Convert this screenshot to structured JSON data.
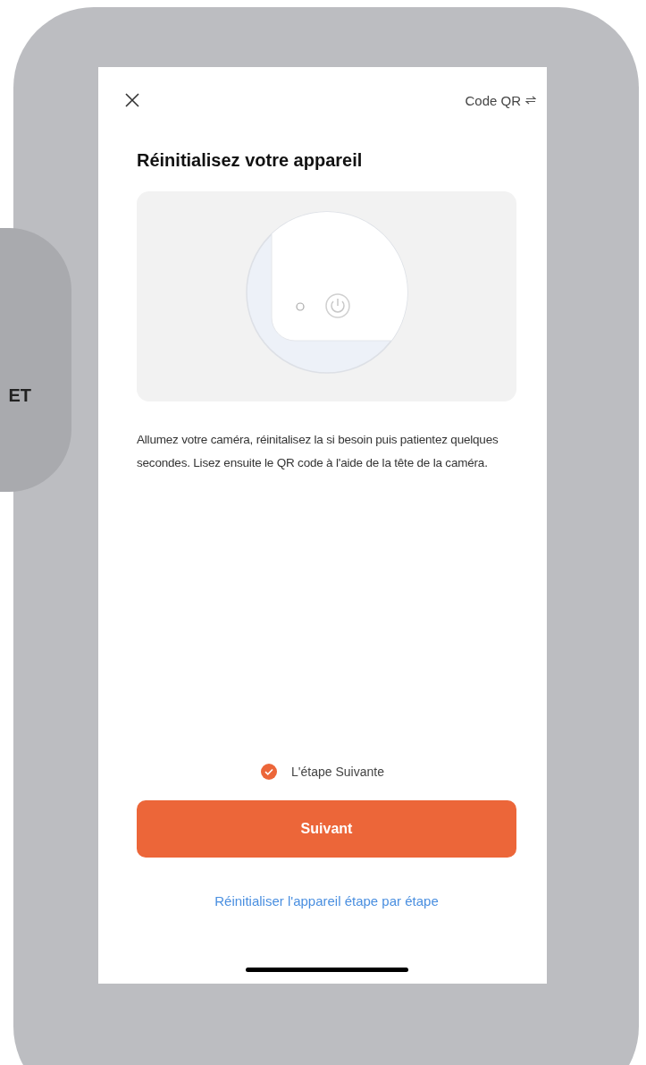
{
  "side_tab": {
    "label": "ET"
  },
  "header": {
    "switch_label": "Code QR"
  },
  "title": "Réinitialisez votre appareil",
  "description": "Allumez votre caméra, réinitalisez la si besoin puis patientez quelques secondes. Lisez ensuite le QR code à l'aide de la tête de la caméra.",
  "confirm": {
    "label": "L'étape Suivante",
    "checked": true
  },
  "primary_button": {
    "label": "Suivant"
  },
  "link": {
    "label": "Réinitialiser l'appareil étape par étape"
  }
}
